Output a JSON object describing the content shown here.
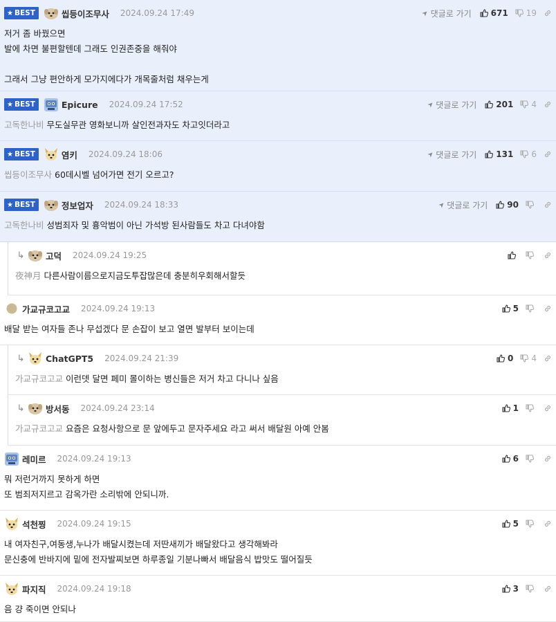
{
  "labels": {
    "best": "BEST",
    "goto": "댓글로 가기"
  },
  "comments": [
    {
      "best": true,
      "reply": false,
      "avatar": "dog-round-icon",
      "nick": "씹등이조무사",
      "date": "2024.09.24 17:49",
      "goto": true,
      "up": "671",
      "down": "19",
      "target": "",
      "lines": [
        "저거 좀 바꿨으면",
        "발에 차면 불편할텐데 그래도 인권존중을 해줘야",
        "",
        "그래서 그냥 편안하게 모가지에다가 개목줄처럼 채우는게"
      ]
    },
    {
      "best": true,
      "reply": false,
      "avatar": "blue-monster-icon",
      "nick": "Epicure",
      "date": "2024.09.24 17:52",
      "goto": true,
      "up": "201",
      "down": "4",
      "target": "고독한나비",
      "lines": [
        "무도실무관 영화보니까 살인전과자도 차고잇더라고"
      ]
    },
    {
      "best": true,
      "reply": false,
      "avatar": "fox-dog-icon",
      "nick": "염키",
      "date": "2024.09.24 18:06",
      "goto": true,
      "up": "131",
      "down": "6",
      "target": "씹등이조무사",
      "lines": [
        "60데시벨 넘어가면 전기 오르고?"
      ]
    },
    {
      "best": true,
      "reply": false,
      "avatar": "dog-round-icon",
      "nick": "정보업자",
      "date": "2024.09.24 18:33",
      "goto": true,
      "up": "90",
      "down": "",
      "target": "고독한나비",
      "lines": [
        "성범죄자 및 흉악범이 아닌 가석방 된사람들도 차고 다녀야함"
      ]
    },
    {
      "best": false,
      "reply": true,
      "avatar": "dog-round-icon",
      "nick": "고덕",
      "date": "2024.09.24 19:25",
      "goto": false,
      "up": "",
      "down": "",
      "target": "夜神月",
      "lines": [
        "다른사람이름으로지금도투잡많은데 충분히우회해서할듯"
      ]
    },
    {
      "best": false,
      "reply": false,
      "avatar": "dot-icon",
      "nick": "가교규코고교",
      "date": "2024.09.24 19:13",
      "goto": false,
      "up": "5",
      "down": "",
      "target": "",
      "lines": [
        "배달 받는 여자들 존나 무섭겠다 문 손잡이 보고 열면 발부터 보이는데"
      ]
    },
    {
      "best": false,
      "reply": true,
      "avatar": "fox-dog-icon",
      "nick": "ChatGPT5",
      "date": "2024.09.24 21:39",
      "goto": false,
      "up": "0",
      "down": "4",
      "target": "가교규코고교",
      "lines": [
        "이런뎃 달면 페미 몰이하는 병신들은 저거 차고 다니나 싶음"
      ]
    },
    {
      "best": false,
      "reply": true,
      "avatar": "dog-round-icon",
      "nick": "방서동",
      "date": "2024.09.24 23:14",
      "goto": false,
      "up": "1",
      "down": "",
      "target": "가교규코고교",
      "lines": [
        "요즘은 요청사항으로 문 앞에두고 문자주세요 라고 써서 배달원 아예 안봄"
      ]
    },
    {
      "best": false,
      "reply": false,
      "avatar": "blue-monster-icon",
      "nick": "레미르",
      "date": "2024.09.24 19:13",
      "goto": false,
      "up": "6",
      "down": "",
      "target": "",
      "lines": [
        "뭐 저런거까지 못하게 하면",
        "또 범죄저지르고 감옥가란 소리밖에 안되니까."
      ]
    },
    {
      "best": false,
      "reply": false,
      "avatar": "fox-dog-icon",
      "nick": "석천찡",
      "date": "2024.09.24 19:15",
      "goto": false,
      "up": "5",
      "down": "",
      "target": "",
      "lines": [
        "내 여자친구,여동생,누나가 배달시켰는데 저딴새끼가 배달왔다고 생각해봐라",
        "문신충에 반바지에 밑에 전자발찌보면 하루종일 기분나빠서 배달음식 밥맛도 떨어질듯"
      ]
    },
    {
      "best": false,
      "reply": false,
      "avatar": "fox-dog-icon",
      "nick": "파지직",
      "date": "2024.09.24 19:18",
      "goto": false,
      "up": "3",
      "down": "",
      "target": "",
      "lines": [
        "음 걍 죽이면 안되나"
      ]
    }
  ]
}
